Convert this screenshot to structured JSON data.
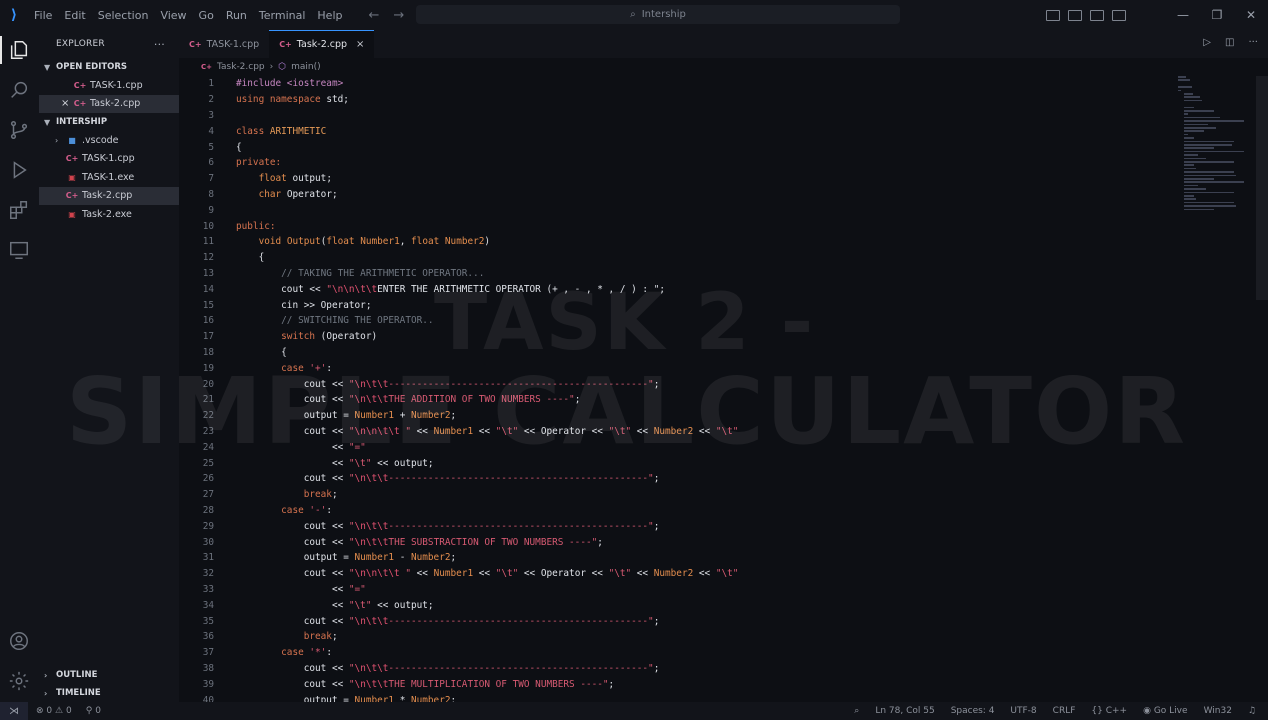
{
  "title_bar": {
    "menu": [
      "File",
      "Edit",
      "Selection",
      "View",
      "Go",
      "Run",
      "Terminal",
      "Help"
    ],
    "search_text": "Intership"
  },
  "sidebar": {
    "header": "EXPLORER",
    "more": "···",
    "open_editors_label": "OPEN EDITORS",
    "open_editors": [
      {
        "name": "TASK-1.cpp",
        "icon": "cpp-file-icon"
      },
      {
        "name": "Task-2.cpp",
        "icon": "cpp-file-icon",
        "close": "×"
      }
    ],
    "folder_label": "INTERSHIP",
    "files": [
      {
        "name": ".vscode",
        "icon": "folder-icon"
      },
      {
        "name": "TASK-1.cpp",
        "icon": "cpp-file-icon"
      },
      {
        "name": "TASK-1.exe",
        "icon": "exe-file-icon"
      },
      {
        "name": "Task-2.cpp",
        "icon": "cpp-file-icon",
        "selected": true
      },
      {
        "name": "Task-2.exe",
        "icon": "exe-file-icon"
      }
    ],
    "outline_label": "OUTLINE",
    "timeline_label": "TIMELINE"
  },
  "tabs": [
    {
      "label": "TASK-1.cpp",
      "active": false
    },
    {
      "label": "Task-2.cpp",
      "active": true,
      "close": "×"
    }
  ],
  "breadcrumb": {
    "file": "Task-2.cpp",
    "sep": "›",
    "symbol": "main()"
  },
  "code_lines": [
    {
      "n": "1",
      "t": [
        [
          "pp",
          "#include <iostream>"
        ]
      ]
    },
    {
      "n": "2",
      "t": [
        [
          "kw",
          "using namespace "
        ],
        [
          "id",
          "std;"
        ]
      ]
    },
    {
      "n": "3",
      "t": []
    },
    {
      "n": "4",
      "t": [
        [
          "kw",
          "class "
        ],
        [
          "cls",
          "ARITHMETIC"
        ]
      ]
    },
    {
      "n": "5",
      "t": [
        [
          "id",
          "{"
        ]
      ]
    },
    {
      "n": "6",
      "t": [
        [
          "kw",
          "private:"
        ]
      ]
    },
    {
      "n": "7",
      "t": [
        [
          "id",
          "    "
        ],
        [
          "ty",
          "float "
        ],
        [
          "id",
          "output;"
        ]
      ]
    },
    {
      "n": "8",
      "t": [
        [
          "id",
          "    "
        ],
        [
          "ty",
          "char "
        ],
        [
          "id",
          "Operator;"
        ]
      ]
    },
    {
      "n": "9",
      "t": []
    },
    {
      "n": "10",
      "t": [
        [
          "kw",
          "public:"
        ]
      ]
    },
    {
      "n": "11",
      "t": [
        [
          "id",
          "    "
        ],
        [
          "ty",
          "void "
        ],
        [
          "fn",
          "Output"
        ],
        [
          "id",
          "("
        ],
        [
          "ty",
          "float "
        ],
        [
          "num",
          "Number1"
        ],
        [
          "id",
          ", "
        ],
        [
          "ty",
          "float "
        ],
        [
          "num",
          "Number2"
        ],
        [
          "id",
          ")"
        ]
      ]
    },
    {
      "n": "12",
      "t": [
        [
          "id",
          "    {"
        ]
      ]
    },
    {
      "n": "13",
      "t": [
        [
          "id",
          "        "
        ],
        [
          "cmt",
          "// TAKING THE ARITHMETIC OPERATOR..."
        ]
      ]
    },
    {
      "n": "14",
      "t": [
        [
          "id",
          "        cout << "
        ],
        [
          "str",
          "\""
        ],
        [
          "esc",
          "\\n\\n\\t\\t"
        ],
        [
          "id",
          "ENTER THE ARITHMETIC OPERATOR (+ , - , * , / ) : \";"
        ]
      ]
    },
    {
      "n": "15",
      "t": [
        [
          "id",
          "        cin >> Operator;"
        ]
      ]
    },
    {
      "n": "16",
      "t": [
        [
          "id",
          "        "
        ],
        [
          "cmt",
          "// SWITCHING THE OPERATOR.."
        ]
      ]
    },
    {
      "n": "17",
      "t": [
        [
          "id",
          "        "
        ],
        [
          "kw",
          "switch "
        ],
        [
          "id",
          "(Operator)"
        ]
      ]
    },
    {
      "n": "18",
      "t": [
        [
          "id",
          "        {"
        ]
      ]
    },
    {
      "n": "19",
      "t": [
        [
          "id",
          "        "
        ],
        [
          "kw",
          "case "
        ],
        [
          "str",
          "'+'"
        ],
        [
          "id",
          ":"
        ]
      ]
    },
    {
      "n": "20",
      "t": [
        [
          "id",
          "            cout << "
        ],
        [
          "str",
          "\""
        ],
        [
          "esc",
          "\\n\\t\\t"
        ],
        [
          "str",
          "----------------------------------------------\""
        ],
        [
          "id",
          ";"
        ]
      ]
    },
    {
      "n": "21",
      "t": [
        [
          "id",
          "            cout << "
        ],
        [
          "str",
          "\""
        ],
        [
          "esc",
          "\\n\\t\\t"
        ],
        [
          "str",
          "THE ADDITION OF TWO NUMBERS ----\""
        ],
        [
          "id",
          ";"
        ]
      ]
    },
    {
      "n": "22",
      "t": [
        [
          "id",
          "            output = "
        ],
        [
          "num",
          "Number1"
        ],
        [
          "id",
          " + "
        ],
        [
          "num",
          "Number2"
        ],
        [
          "id",
          ";"
        ]
      ]
    },
    {
      "n": "23",
      "t": [
        [
          "id",
          "            cout << "
        ],
        [
          "str",
          "\""
        ],
        [
          "esc",
          "\\n\\n\\t\\t"
        ],
        [
          "str",
          " \""
        ],
        [
          "id",
          " << "
        ],
        [
          "num",
          "Number1"
        ],
        [
          "id",
          " << "
        ],
        [
          "str",
          "\"\\t\""
        ],
        [
          "id",
          " << Operator << "
        ],
        [
          "str",
          "\"\\t\""
        ],
        [
          "id",
          " << "
        ],
        [
          "num",
          "Number2"
        ],
        [
          "id",
          " << "
        ],
        [
          "str",
          "\"\\t\""
        ]
      ]
    },
    {
      "n": "24",
      "t": [
        [
          "id",
          "                 << "
        ],
        [
          "str",
          "\"=\""
        ]
      ]
    },
    {
      "n": "25",
      "t": [
        [
          "id",
          "                 << "
        ],
        [
          "str",
          "\"\\t\""
        ],
        [
          "id",
          " << output;"
        ]
      ]
    },
    {
      "n": "26",
      "t": [
        [
          "id",
          "            cout << "
        ],
        [
          "str",
          "\""
        ],
        [
          "esc",
          "\\n\\t\\t"
        ],
        [
          "str",
          "----------------------------------------------\""
        ],
        [
          "id",
          ";"
        ]
      ]
    },
    {
      "n": "27",
      "t": [
        [
          "id",
          "            "
        ],
        [
          "kw",
          "break"
        ],
        [
          "id",
          ";"
        ]
      ]
    },
    {
      "n": "28",
      "t": [
        [
          "id",
          "        "
        ],
        [
          "kw",
          "case "
        ],
        [
          "str",
          "'-'"
        ],
        [
          "id",
          ":"
        ]
      ]
    },
    {
      "n": "29",
      "t": [
        [
          "id",
          "            cout << "
        ],
        [
          "str",
          "\""
        ],
        [
          "esc",
          "\\n\\t\\t"
        ],
        [
          "str",
          "----------------------------------------------\""
        ],
        [
          "id",
          ";"
        ]
      ]
    },
    {
      "n": "30",
      "t": [
        [
          "id",
          "            cout << "
        ],
        [
          "str",
          "\""
        ],
        [
          "esc",
          "\\n\\t\\t"
        ],
        [
          "str",
          "THE SUBSTRACTION OF TWO NUMBERS ----\""
        ],
        [
          "id",
          ";"
        ]
      ]
    },
    {
      "n": "31",
      "t": [
        [
          "id",
          "            output = "
        ],
        [
          "num",
          "Number1"
        ],
        [
          "id",
          " - "
        ],
        [
          "num",
          "Number2"
        ],
        [
          "id",
          ";"
        ]
      ]
    },
    {
      "n": "32",
      "t": [
        [
          "id",
          "            cout << "
        ],
        [
          "str",
          "\""
        ],
        [
          "esc",
          "\\n\\n\\t\\t"
        ],
        [
          "str",
          " \""
        ],
        [
          "id",
          " << "
        ],
        [
          "num",
          "Number1"
        ],
        [
          "id",
          " << "
        ],
        [
          "str",
          "\"\\t\""
        ],
        [
          "id",
          " << Operator << "
        ],
        [
          "str",
          "\"\\t\""
        ],
        [
          "id",
          " << "
        ],
        [
          "num",
          "Number2"
        ],
        [
          "id",
          " << "
        ],
        [
          "str",
          "\"\\t\""
        ]
      ]
    },
    {
      "n": "33",
      "t": [
        [
          "id",
          "                 << "
        ],
        [
          "str",
          "\"=\""
        ]
      ]
    },
    {
      "n": "34",
      "t": [
        [
          "id",
          "                 << "
        ],
        [
          "str",
          "\"\\t\""
        ],
        [
          "id",
          " << output;"
        ]
      ]
    },
    {
      "n": "35",
      "t": [
        [
          "id",
          "            cout << "
        ],
        [
          "str",
          "\""
        ],
        [
          "esc",
          "\\n\\t\\t"
        ],
        [
          "str",
          "----------------------------------------------\""
        ],
        [
          "id",
          ";"
        ]
      ]
    },
    {
      "n": "36",
      "t": [
        [
          "id",
          "            "
        ],
        [
          "kw",
          "break"
        ],
        [
          "id",
          ";"
        ]
      ]
    },
    {
      "n": "37",
      "t": [
        [
          "id",
          "        "
        ],
        [
          "kw",
          "case "
        ],
        [
          "str",
          "'*'"
        ],
        [
          "id",
          ":"
        ]
      ]
    },
    {
      "n": "38",
      "t": [
        [
          "id",
          "            cout << "
        ],
        [
          "str",
          "\""
        ],
        [
          "esc",
          "\\n\\t\\t"
        ],
        [
          "str",
          "----------------------------------------------\""
        ],
        [
          "id",
          ";"
        ]
      ]
    },
    {
      "n": "39",
      "t": [
        [
          "id",
          "            cout << "
        ],
        [
          "str",
          "\""
        ],
        [
          "esc",
          "\\n\\t\\t"
        ],
        [
          "str",
          "THE MULTIPLICATION OF TWO NUMBERS ----\""
        ],
        [
          "id",
          ";"
        ]
      ]
    },
    {
      "n": "40",
      "t": [
        [
          "id",
          "            output = "
        ],
        [
          "num",
          "Number1"
        ],
        [
          "id",
          " * "
        ],
        [
          "num",
          "Number2"
        ],
        [
          "id",
          ";"
        ]
      ]
    }
  ],
  "watermark": {
    "line1": "TASK 2 -",
    "line2": "SIMPLE CALCULATOR"
  },
  "status_bar": {
    "errors": "0",
    "warnings": "0",
    "ports": "0",
    "position": "Ln 78, Col 55",
    "spaces": "Spaces: 4",
    "encoding": "UTF-8",
    "eol": "CRLF",
    "language": "C++",
    "go_live": "Go Live",
    "platform": "Win32"
  },
  "colors": {
    "accent": "#3794ff",
    "background": "#0d0f14",
    "keyword": "#d6734f",
    "string": "#d75a72"
  }
}
